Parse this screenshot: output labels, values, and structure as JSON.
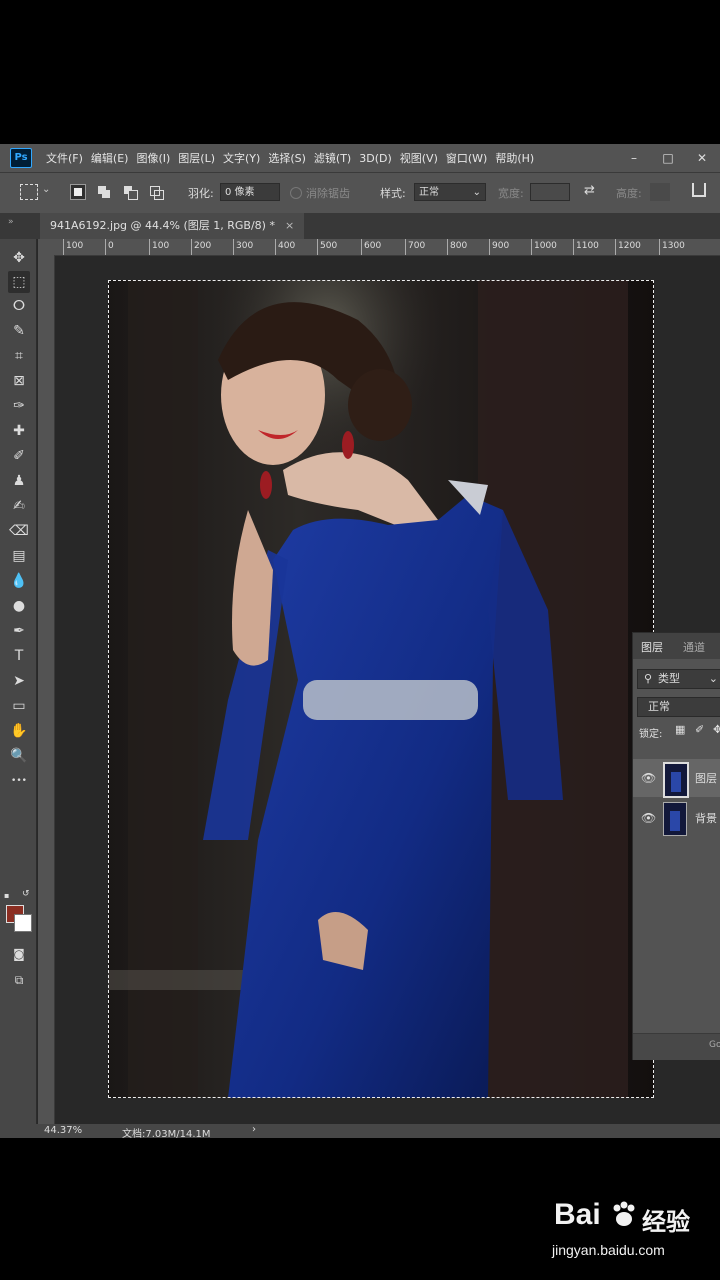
{
  "menu": {
    "logo": "Ps",
    "items": [
      "文件(F)",
      "编辑(E)",
      "图像(I)",
      "图层(L)",
      "文字(Y)",
      "选择(S)",
      "滤镜(T)",
      "3D(D)",
      "视图(V)",
      "窗口(W)",
      "帮助(H)"
    ],
    "minimize": "–",
    "restore": "□",
    "close": "✕"
  },
  "options": {
    "feather_label": "羽化:",
    "feather_value": "0 像素",
    "antialias_label": "消除锯齿",
    "style_label": "样式:",
    "style_value": "正常",
    "width_label": "宽度:",
    "height_label": "高度:",
    "swap_icon": "⇄"
  },
  "document": {
    "tab_title": "941A6192.jpg @ 44.4% (图层 1, RGB/8) *",
    "tab_close": "×"
  },
  "ruler": {
    "top_ticks": [
      "100",
      "0",
      "100",
      "200",
      "300",
      "400",
      "500",
      "600",
      "700",
      "800",
      "900",
      "1000",
      "1100",
      "1200",
      "1300"
    ]
  },
  "tools": [
    {
      "name": "move-tool-icon",
      "glyph": "✥"
    },
    {
      "name": "marquee-tool-icon",
      "glyph": "⬚"
    },
    {
      "name": "lasso-tool-icon",
      "glyph": "ⵔ"
    },
    {
      "name": "quick-select-tool-icon",
      "glyph": "✎"
    },
    {
      "name": "crop-tool-icon",
      "glyph": "⌗"
    },
    {
      "name": "frame-tool-icon",
      "glyph": "⊠"
    },
    {
      "name": "eyedropper-tool-icon",
      "glyph": "✑"
    },
    {
      "name": "healing-brush-tool-icon",
      "glyph": "✚"
    },
    {
      "name": "brush-tool-icon",
      "glyph": "✐"
    },
    {
      "name": "stamp-tool-icon",
      "glyph": "♟"
    },
    {
      "name": "history-brush-tool-icon",
      "glyph": "✍"
    },
    {
      "name": "eraser-tool-icon",
      "glyph": "⌫"
    },
    {
      "name": "gradient-tool-icon",
      "glyph": "▤"
    },
    {
      "name": "blur-tool-icon",
      "glyph": "💧"
    },
    {
      "name": "dodge-tool-icon",
      "glyph": "●"
    },
    {
      "name": "pen-tool-icon",
      "glyph": "✒"
    },
    {
      "name": "type-tool-icon",
      "glyph": "T"
    },
    {
      "name": "path-select-tool-icon",
      "glyph": "➤"
    },
    {
      "name": "rectangle-tool-icon",
      "glyph": "▭"
    },
    {
      "name": "hand-tool-icon",
      "glyph": "✋"
    },
    {
      "name": "zoom-tool-icon",
      "glyph": "🔍"
    },
    {
      "name": "more-tools-icon",
      "glyph": "•••"
    }
  ],
  "status": {
    "zoom": "44.37%",
    "doc_info": "文档:7.03M/14.1M",
    "arrow": "›"
  },
  "layers_panel": {
    "tab_layers": "图层",
    "tab_channels": "通道",
    "filter_label": "类型",
    "blend_mode": "正常",
    "lock_label": "锁定:",
    "layers": [
      {
        "name": "图层"
      },
      {
        "name": "背景"
      }
    ],
    "footer": "Go"
  },
  "watermark": {
    "brand": "Bai",
    "brand_suffix": "经验",
    "url": "jingyan.baidu.com"
  }
}
